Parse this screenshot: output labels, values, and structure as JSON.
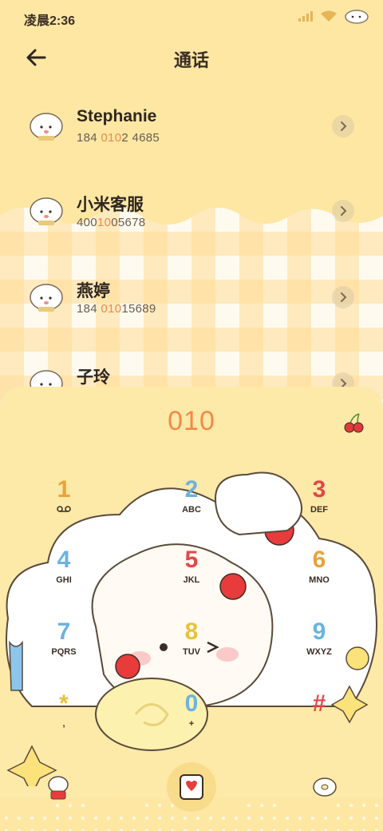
{
  "status": {
    "time": "凌晨2:36"
  },
  "header": {
    "title": "通话"
  },
  "contacts": [
    {
      "name": "Stephanie",
      "num_pre": "184 ",
      "num_hl": "010",
      "num_post": "2 4685"
    },
    {
      "name": "小米客服",
      "num_pre": "400",
      "num_hl": "10",
      "num_post": "05678"
    },
    {
      "name": "燕婷",
      "num_pre": "184 ",
      "num_hl": "010",
      "num_post": "15689"
    },
    {
      "name": "子玲",
      "num_pre": "",
      "num_hl": "",
      "num_post": ""
    }
  ],
  "dialpad": {
    "dialed": "010",
    "keys": [
      {
        "digit": "1",
        "letters": "",
        "color": "#e9a23b"
      },
      {
        "digit": "2",
        "letters": "ABC",
        "color": "#6bb3e0"
      },
      {
        "digit": "3",
        "letters": "DEF",
        "color": "#e04848"
      },
      {
        "digit": "4",
        "letters": "GHI",
        "color": "#6bb3e0"
      },
      {
        "digit": "5",
        "letters": "JKL",
        "color": "#e04848"
      },
      {
        "digit": "6",
        "letters": "MNO",
        "color": "#e9a23b"
      },
      {
        "digit": "7",
        "letters": "PQRS",
        "color": "#6bb3e0"
      },
      {
        "digit": "8",
        "letters": "TUV",
        "color": "#e9c23b"
      },
      {
        "digit": "9",
        "letters": "WXYZ",
        "color": "#6bb3e0"
      },
      {
        "digit": "*",
        "letters": ",",
        "color": "#e9c23b"
      },
      {
        "digit": "0",
        "letters": "+",
        "color": "#6bb3e0"
      },
      {
        "digit": "#",
        "letters": "",
        "color": "#e04848"
      }
    ]
  },
  "colors": {
    "accent": "#f28a47",
    "background": "#fde7a3"
  }
}
